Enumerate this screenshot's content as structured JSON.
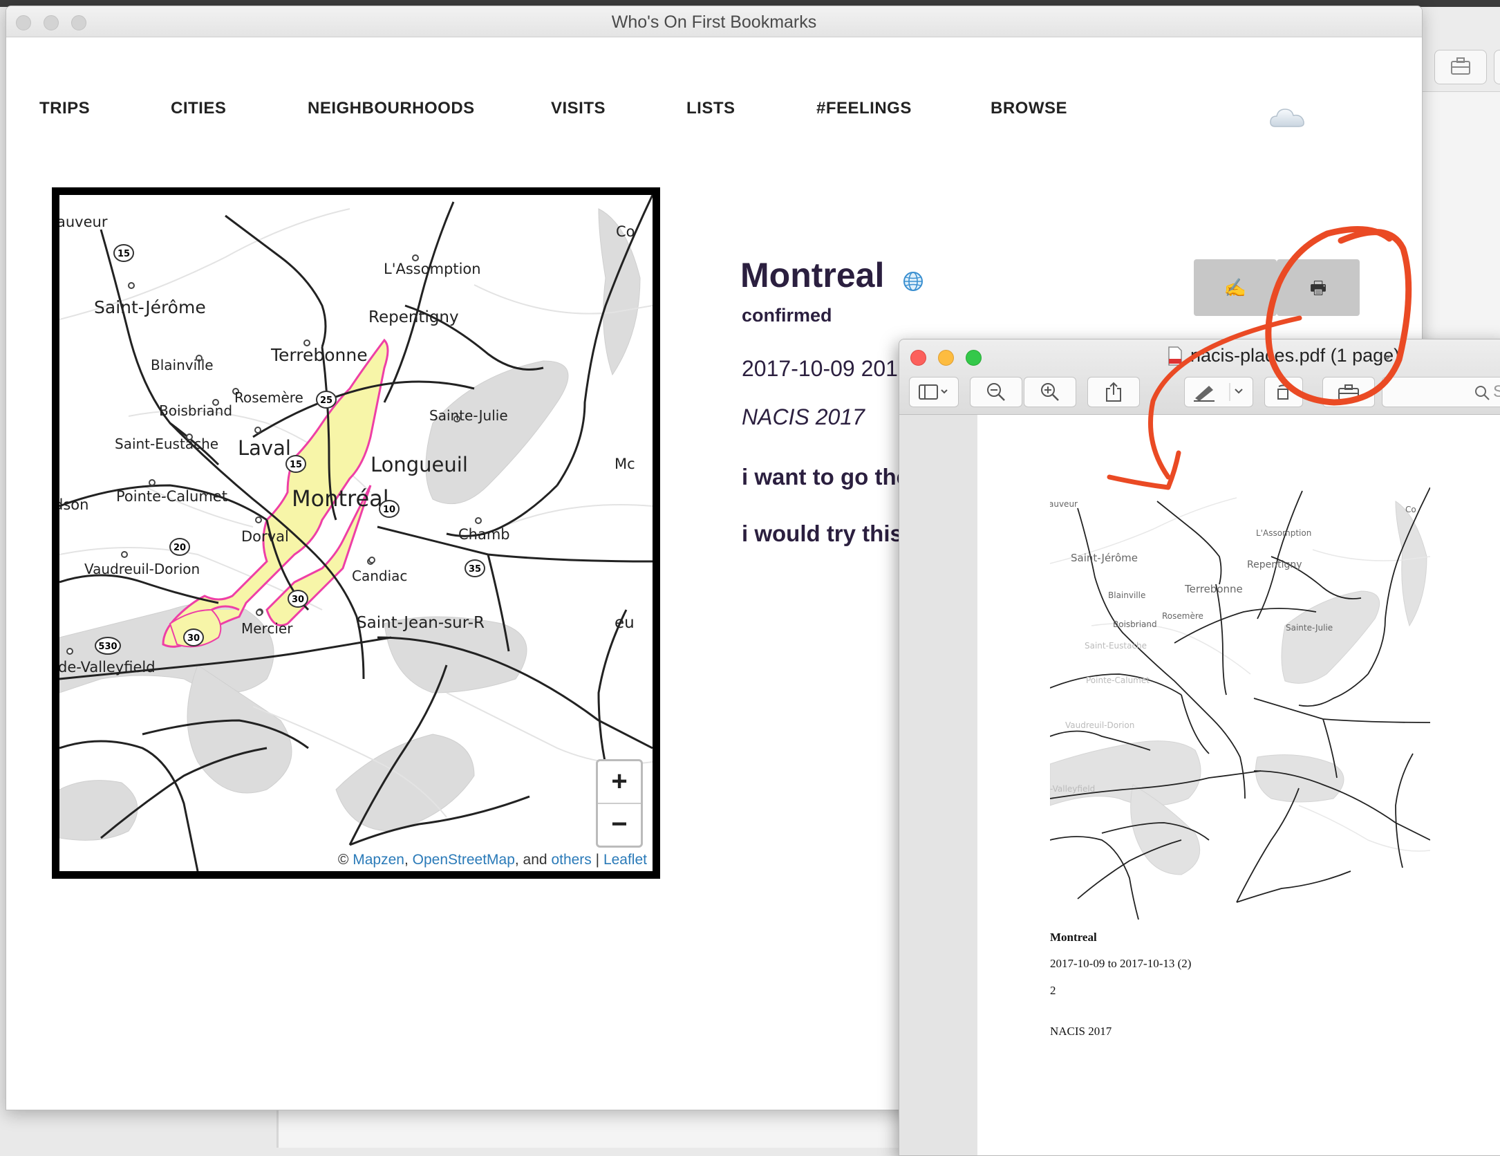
{
  "main_window": {
    "title": "Who's On First Bookmarks"
  },
  "nav": {
    "items": [
      {
        "label": "TRIPS"
      },
      {
        "label": "CITIES"
      },
      {
        "label": "NEIGHBOURHOODS"
      },
      {
        "label": "VISITS"
      },
      {
        "label": "LISTS"
      },
      {
        "label": "#FEELINGS"
      },
      {
        "label": "BROWSE"
      }
    ],
    "cloud_icon": "cloud-icon"
  },
  "map": {
    "labels": {
      "sauveur": "auveur",
      "co": "Co",
      "lassomption": "L'Assomption",
      "saintjerome": "Saint-Jérôme",
      "repentigny": "Repentigny",
      "terrebonne": "Terrebonne",
      "blainville": "Blainville",
      "rosemere": "Rosemère",
      "boisbriand": "Boisbriand",
      "saintejulie": "Sainte-Julie",
      "sainteustache": "Saint-Eustache",
      "laval": "Laval",
      "longueuil": "Longueuil",
      "mc": "Mc",
      "pointecalumet": "Pointe-Calumet",
      "dson": "dson",
      "montreal": "Montréal",
      "dorval": "Dorval",
      "chamb": "Chamb",
      "vaudreuil": "Vaudreuil-Dorion",
      "candiac": "Candiac",
      "mercier": "Mercier",
      "sjsr": "Saint-Jean-sur-R",
      "eu": "eu",
      "valleyfield": "de-Valleyfield"
    },
    "shields": {
      "a15": "15",
      "a25": "25",
      "a15b": "15",
      "a10": "10",
      "a20": "20",
      "a35": "35",
      "a30": "30",
      "a30b": "30",
      "a530": "530"
    },
    "zoom_in": "+",
    "zoom_out": "−",
    "attribution": {
      "copyright": "© ",
      "mapzen": "Mapzen",
      "sep1": ", ",
      "osm": "OpenStreetMap",
      "sep2": ", and ",
      "others": "others",
      "sep3": " | ",
      "leaflet": "Leaflet"
    },
    "colors": {
      "polygon_fill": "#f7f5a8",
      "polygon_stroke": "#ee3fa6",
      "water": "#dcdcdc",
      "roads": "#222222"
    }
  },
  "place": {
    "name": "Montreal",
    "status": "confirmed",
    "dates_visible": "2017-10-09   201",
    "event": "NACIS 2017",
    "note1_visible": "i want to go the",
    "note2_visible": "i would try this",
    "edit_icon": "✍",
    "print_icon": "🖶"
  },
  "preview": {
    "filename": "nacis-places.pdf (1 page)",
    "page": {
      "title": "Montreal",
      "dates": "2017-10-09 to 2017-10-13 (2)",
      "count": "2",
      "event": "NACIS 2017"
    },
    "map_labels": {
      "sauveur": "auveur",
      "co": "Co",
      "lassomption": "L'Assomption",
      "saintjerome": "Saint-Jérôme",
      "repentigny": "Repentigny",
      "terrebonne": "Terrebonne",
      "blainville": "Blainville",
      "rosemere": "Rosemère",
      "boisbriand": "Boisbriand",
      "saintejulie": "Sainte-Julie",
      "sainteustache": "Saint-Eustache",
      "pointecalumet": "Pointe-Calumet",
      "vaudreuil": "Vaudreuil-Dorion",
      "valleyfield": "-Valleyfield"
    },
    "toolbar_icons": [
      "sidebar-icon",
      "zoom-out-icon",
      "zoom-in-icon",
      "share-icon",
      "markup-icon",
      "rotate-icon",
      "toolbox-icon",
      "search-icon"
    ],
    "search_placeholder": "S"
  },
  "annotation": {
    "color": "#ea4a24"
  }
}
